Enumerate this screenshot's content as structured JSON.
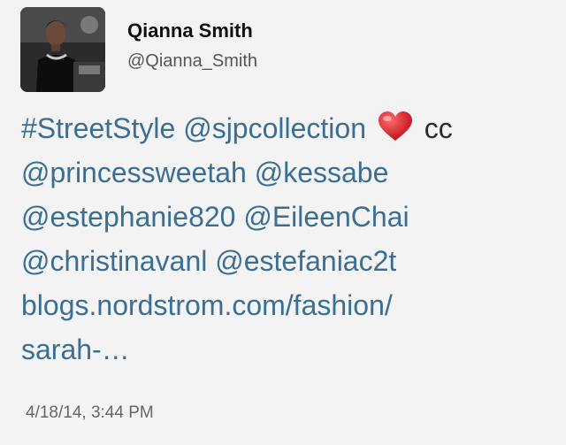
{
  "user": {
    "name": "Qianna Smith",
    "handle": "@Qianna_Smith"
  },
  "tweet": {
    "hashtag": "#StreetStyle",
    "mention_sjp": "@sjpcollection",
    "heart_icon": "red-heart-emoji",
    "cc": "cc",
    "mention_princess": "@princessweetah",
    "mention_kessabe": "@kessabe",
    "mention_estephanie": "@estephanie820",
    "mention_eileen": "@EileenChai",
    "mention_christina": "@christinavanl",
    "mention_estefania": "@estefaniac2t",
    "link_line1": "blogs.nordstrom.com/fashion/",
    "link_line2": "sarah-…",
    "timestamp": "4/18/14, 3:44 PM"
  },
  "colors": {
    "link": "#3a6f93",
    "text": "#2c2c2c",
    "heart": "#d4202a",
    "background": "#f3f3f3"
  }
}
